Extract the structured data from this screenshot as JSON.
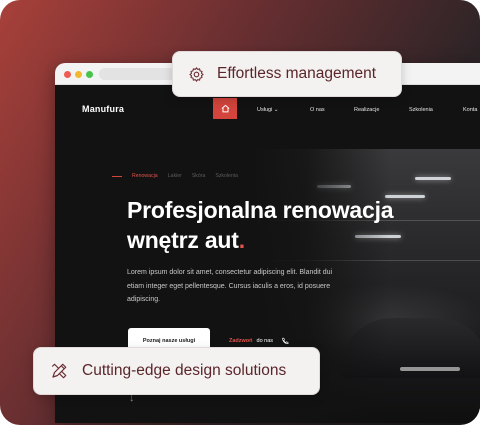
{
  "colors": {
    "accent": "#d2443c",
    "pill_text": "#5a2629",
    "background_dark": "#121212"
  },
  "badges": {
    "top": {
      "label": "Effortless management",
      "icon": "gear-icon"
    },
    "bottom": {
      "label": "Cutting-edge design solutions",
      "icon": "design-tools-icon"
    }
  },
  "site": {
    "logo": "Manufura",
    "nav": {
      "home_icon": "home-icon",
      "items": [
        {
          "label": "Usługi",
          "dropdown": true
        },
        {
          "label": "O nas"
        },
        {
          "label": "Realizacje"
        },
        {
          "label": "Szkolenia"
        },
        {
          "label": "Konta"
        }
      ]
    },
    "breadcrumbs": {
      "active": "Renowacja",
      "items": [
        "Lakier",
        "Skóra",
        "Szkolenia"
      ]
    },
    "hero": {
      "title_line1": "Profesjonalna renowacja",
      "title_line2": "wnętrz aut",
      "title_period": ".",
      "body": "Lorem ipsum dolor sit amet, consectetur adipiscing elit. Blandit dui etiam integer eget pellentesque. Cursus iaculis a eros, id posuere adipiscing."
    },
    "cta": {
      "label": "Poznaj nasze usługi"
    },
    "call": {
      "highlight": "Zadzwoń",
      "rest": "do nas",
      "icon": "phone-icon"
    },
    "scroll_icon": "arrow-down-icon"
  }
}
